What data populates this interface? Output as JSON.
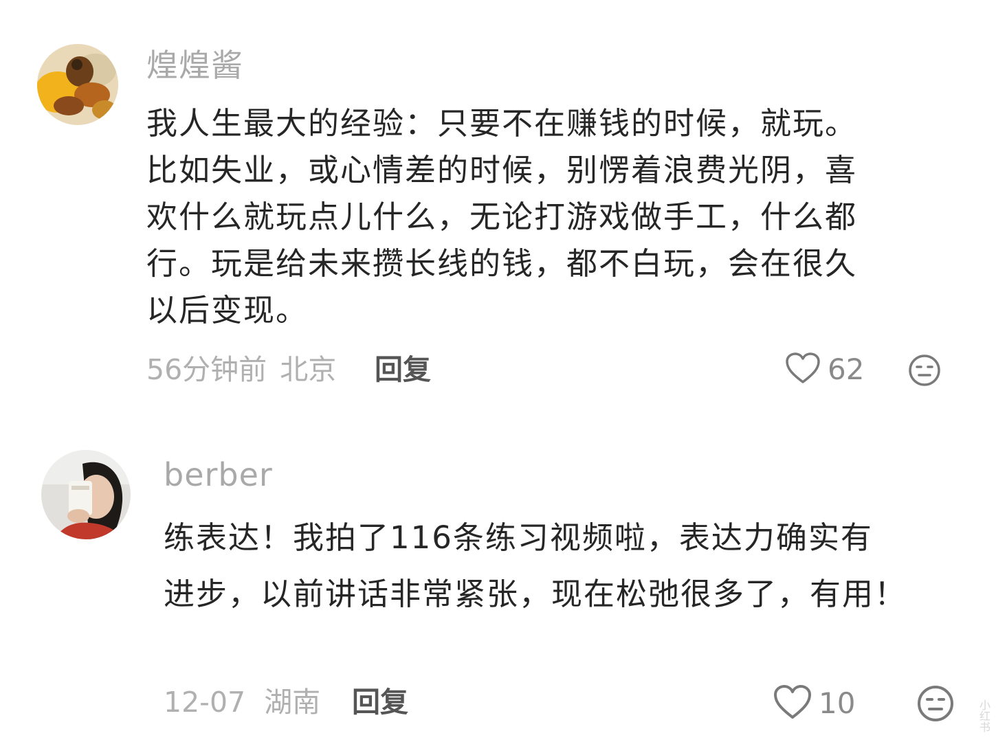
{
  "comments": [
    {
      "username": "煌煌酱",
      "lines": [
        "我人生最大的经验：只要不在赚钱的时候，就玩。",
        "比如失业，或心情差的时候，别愣着浪费光阴，喜",
        "欢什么就玩点儿什么，无论打游戏做手工，什么都",
        "行。玩是给未来攒长线的钱，都不白玩，会在很久",
        "以后变现。"
      ],
      "time": "56分钟前",
      "location": "北京",
      "reply_label": "回复",
      "likes": "62",
      "icons": {
        "like": "heart-outline-icon",
        "reaction": "neutral-face-icon"
      }
    },
    {
      "username": "berber",
      "lines": [
        "练表达！我拍了116条练习视频啦，表达力确实有",
        "进步，以前讲话非常紧张，现在松弛很多了，有用！"
      ],
      "time": "12-07",
      "location": "湖南",
      "reply_label": "回复",
      "likes": "10",
      "icons": {
        "like": "heart-outline-icon",
        "reaction": "neutral-face-icon"
      }
    }
  ],
  "watermark": "小红书",
  "colors": {
    "username": "#a9a9a9",
    "body": "#262626",
    "meta": "#b0b0b0",
    "reply": "#555555",
    "icon": "#7a7a7a"
  }
}
